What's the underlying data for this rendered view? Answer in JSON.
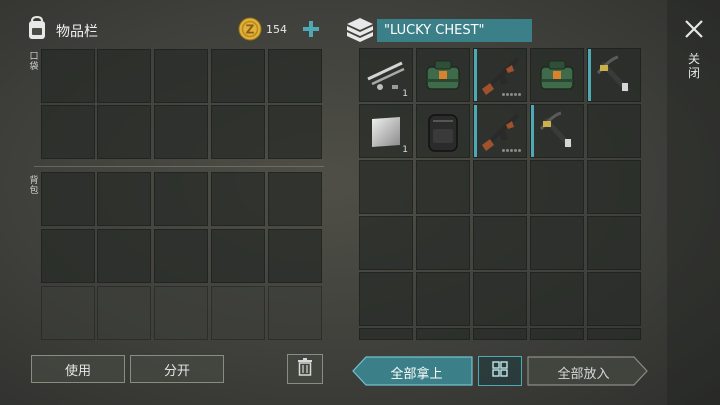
{
  "inventory": {
    "title": "物品栏",
    "pocket_label": "口袋",
    "backpack_label": "背包"
  },
  "currency": {
    "amount": "154",
    "icon": "gold-coin-icon",
    "add_icon": "plus-icon"
  },
  "chest": {
    "title": "\"LUCKY CHEST\"",
    "icon": "chest-box-icon",
    "items": [
      {
        "name": "item-pipe-parts",
        "qty": "1"
      },
      {
        "name": "item-green-supply-bag",
        "qty": ""
      },
      {
        "name": "item-assault-rifle",
        "qty": ""
      },
      {
        "name": "item-green-supply-bag",
        "qty": ""
      },
      {
        "name": "item-crossbow",
        "qty": ""
      },
      {
        "name": "item-metal-plate",
        "qty": "1"
      },
      {
        "name": "item-black-backpack",
        "qty": ""
      },
      {
        "name": "item-assault-rifle",
        "qty": ""
      },
      {
        "name": "item-crossbow",
        "qty": ""
      }
    ]
  },
  "buttons": {
    "use": "使用",
    "split": "分开",
    "take_all": "全部拿上",
    "put_all": "全部放入",
    "close": "关闭"
  },
  "colors": {
    "accent_teal": "#4fa9b5",
    "coin_gold": "#e0b23a"
  }
}
